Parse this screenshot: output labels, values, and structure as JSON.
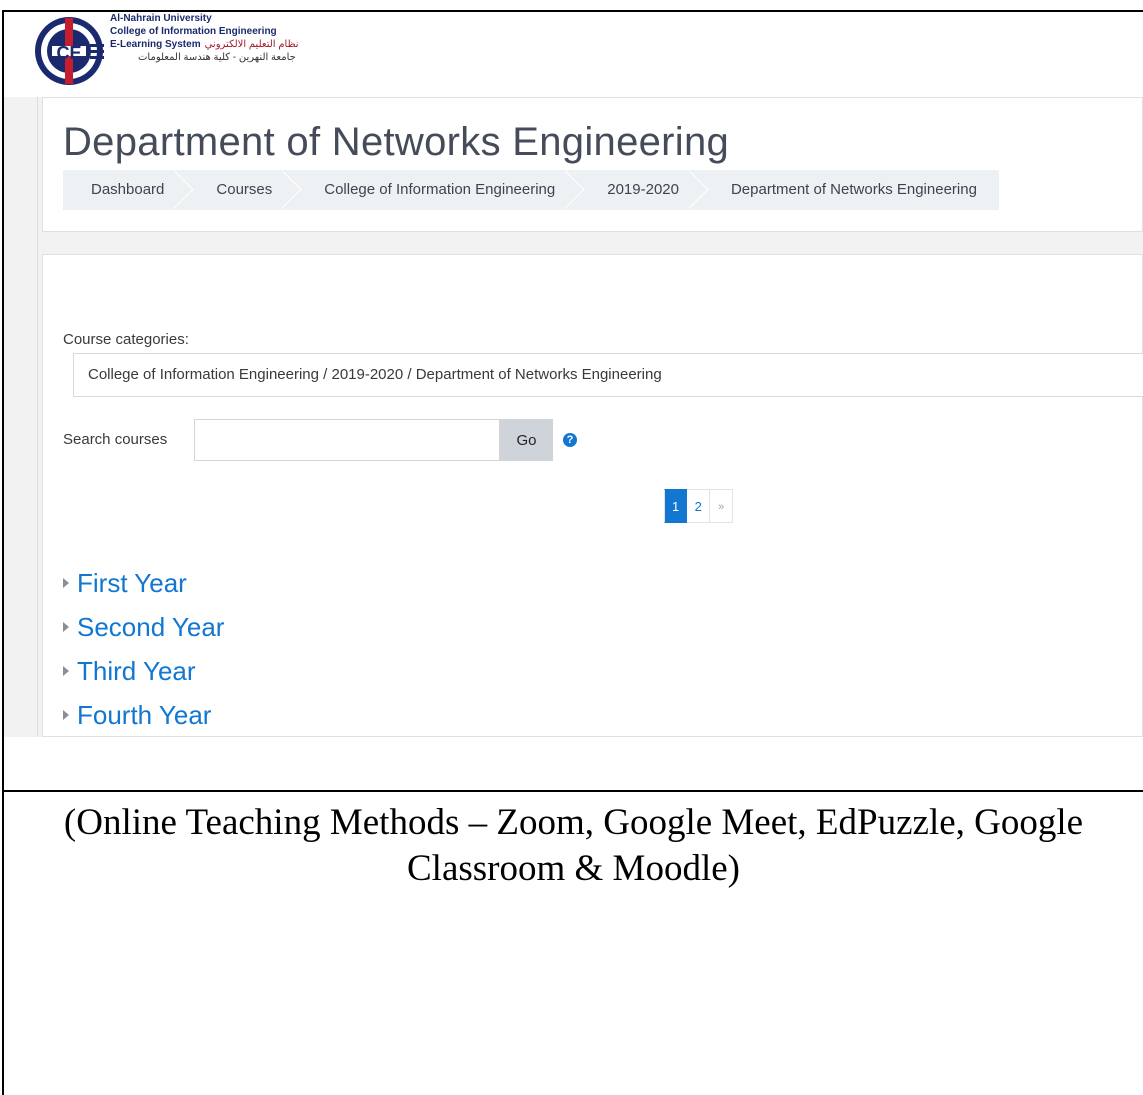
{
  "logo": {
    "line1": "Al-Nahrain University",
    "line2": "College of Information Engineering",
    "line3_en": "E-Learning System",
    "line3_ar": "نظام التعليم الالكتروني",
    "line4_ar": "جامعة النهرين - كلية هندسة المعلومات",
    "monogram": "CE"
  },
  "header": {
    "title": "Department of Networks Engineering",
    "breadcrumb": [
      "Dashboard",
      "Courses",
      "College of Information Engineering",
      "2019-2020",
      "Department of Networks Engineering"
    ]
  },
  "main": {
    "categories_label": "Course categories:",
    "categories_selected": "College of Information Engineering / 2019-2020 / Department of Networks Engineering",
    "search_label": "Search courses",
    "search_value": "",
    "go_label": "Go",
    "help_glyph": "?",
    "pagination": [
      "1",
      "2",
      "»"
    ],
    "pagination_active": "1",
    "category_items": [
      "First Year",
      "Second Year",
      "Third Year",
      "Fourth Year"
    ]
  },
  "caption": {
    "line1": "(Online Teaching Methods – Zoom, Google Meet, EdPuzzle, Google",
    "line2": "Classroom & Moodle)"
  },
  "colors": {
    "accent": "#1177d1",
    "title": "#454c59",
    "breadcrumb_bg": "#eef1f4",
    "go_button": "#ced4da",
    "page_bg": "#f2f2f2"
  },
  "icons": {
    "help": "question-circle-icon",
    "expand": "triangle-right-icon"
  }
}
